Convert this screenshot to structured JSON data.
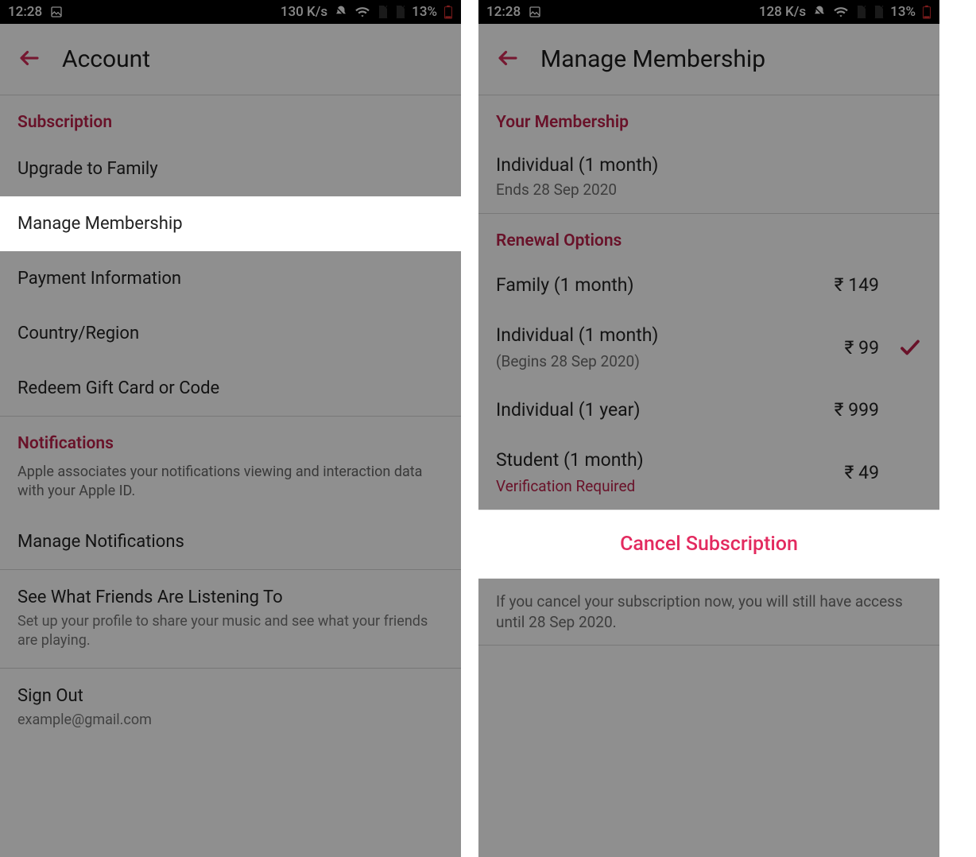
{
  "left": {
    "status": {
      "time": "12:28",
      "speed": "130 K/s",
      "battery": "13%"
    },
    "title": "Account",
    "subscription_header": "Subscription",
    "rows": {
      "upgrade": "Upgrade to Family",
      "manage": "Manage Membership",
      "payment": "Payment Information",
      "country": "Country/Region",
      "redeem": "Redeem Gift Card or Code"
    },
    "notifications_header": "Notifications",
    "notifications_sub": "Apple associates your notifications viewing and interaction data with your Apple ID.",
    "manage_notifications": "Manage Notifications",
    "friends_title": "See What Friends Are Listening To",
    "friends_sub": "Set up your profile to share your music and see what your friends are playing.",
    "signout": "Sign Out",
    "signout_email": "example@gmail.com"
  },
  "right": {
    "status": {
      "time": "12:28",
      "speed": "128 K/s",
      "battery": "13%"
    },
    "title": "Manage Membership",
    "your_membership_header": "Your Membership",
    "membership_title": "Individual (1 month)",
    "membership_sub": "Ends 28 Sep 2020",
    "renewal_header": "Renewal Options",
    "options": [
      {
        "title": "Family (1 month)",
        "sub": "",
        "price": "₹ 149",
        "selected": false
      },
      {
        "title": "Individual (1 month)",
        "sub": "(Begins 28 Sep 2020)",
        "price": "₹ 99",
        "selected": true
      },
      {
        "title": "Individual (1 year)",
        "sub": "",
        "price": "₹ 999",
        "selected": false
      },
      {
        "title": "Student (1 month)",
        "sub": "Verification Required",
        "sub_red": true,
        "price": "₹ 49",
        "selected": false
      }
    ],
    "cancel": "Cancel Subscription",
    "footnote": "If you cancel your subscription now, you will still have access until 28 Sep 2020."
  }
}
